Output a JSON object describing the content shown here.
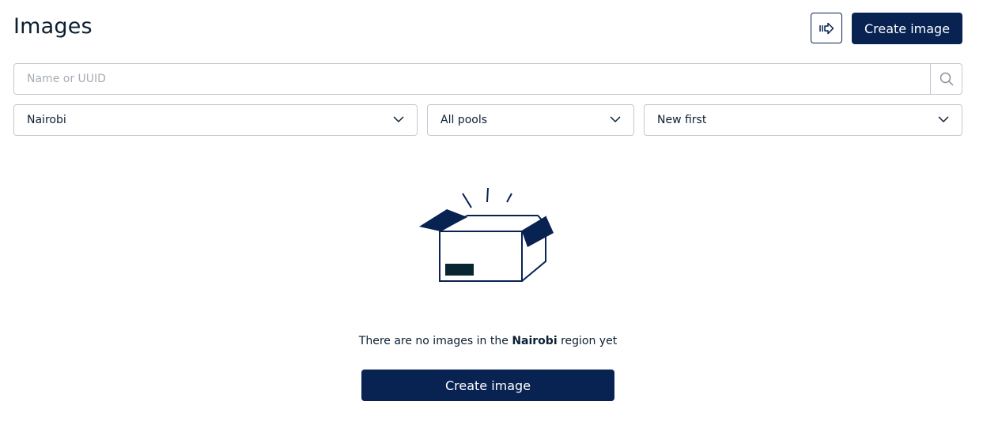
{
  "header": {
    "title": "Images",
    "import_icon": "arrow-right-import-icon",
    "create_label": "Create image"
  },
  "search": {
    "placeholder": "Name or UUID",
    "value": "",
    "icon": "search-icon"
  },
  "filters": {
    "region": "Nairobi",
    "pool": "All pools",
    "sort": "New first"
  },
  "empty_state": {
    "illustration": "open-box-icon",
    "text_before": "There are no images in the ",
    "region": "Nairobi",
    "text_after": " region yet",
    "create_label": "Create image"
  },
  "colors": {
    "primary": "#082252",
    "border": "#c4c9d0",
    "text": "#0b1f33"
  }
}
